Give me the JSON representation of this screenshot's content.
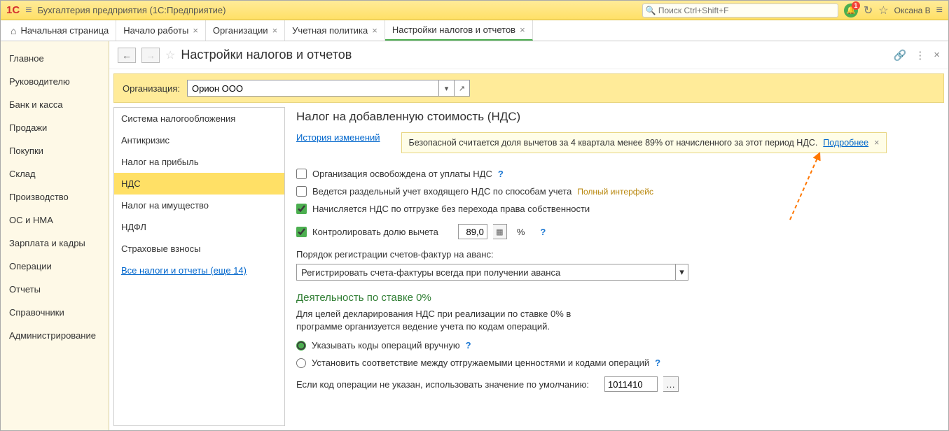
{
  "topbar": {
    "app_title": "Бухгалтерия предприятия  (1С:Предприятие)",
    "search_placeholder": "Поиск Ctrl+Shift+F",
    "bell_count": "1",
    "user_name": "Оксана В"
  },
  "tabs": [
    {
      "label": "Начальная страница",
      "home": true
    },
    {
      "label": "Начало работы"
    },
    {
      "label": "Организации"
    },
    {
      "label": "Учетная политика"
    },
    {
      "label": "Настройки налогов и отчетов",
      "active": true
    }
  ],
  "sidenav": [
    "Главное",
    "Руководителю",
    "Банк и касса",
    "Продажи",
    "Покупки",
    "Склад",
    "Производство",
    "ОС и НМА",
    "Зарплата и кадры",
    "Операции",
    "Отчеты",
    "Справочники",
    "Администрирование"
  ],
  "page_title": "Настройки налогов и отчетов",
  "org": {
    "label": "Организация:",
    "value": "Орион ООО"
  },
  "settings_nav": [
    "Система налогообложения",
    "Антикризис",
    "Налог на прибыль",
    "НДС",
    "Налог на имущество",
    "НДФЛ",
    "Страховые взносы"
  ],
  "settings_nav_link": "Все налоги и отчеты (еще 14)",
  "form": {
    "heading": "Налог на добавленную стоимость (НДС)",
    "history_link": "История изменений",
    "notice_text": "Безопасной считается доля вычетов за 4 квартала менее 89% от начисленного за этот период НДС.",
    "notice_more": "Подробнее",
    "cb_exempt": "Организация освобождена от уплаты НДС",
    "cb_separate": "Ведется раздельный учет входящего НДС по способам учета",
    "cb_separate_hint": "Полный интерфейс",
    "cb_shipment": "Начисляется НДС по отгрузке без перехода права собственности",
    "cb_control": "Контролировать долю вычета",
    "control_value": "89,0",
    "percent": "%",
    "order_label": "Порядок регистрации счетов-фактур на аванс:",
    "order_value": "Регистрировать счета-фактуры всегда при получении аванса",
    "zero_heading": "Деятельность по ставке 0%",
    "zero_desc": "Для целей декларирования НДС при реализации по ставке 0% в программе организуется ведение учета по кодам операций.",
    "radio_manual": "Указывать коды операций вручную",
    "radio_auto": "Установить соответствие между отгружаемыми ценностями и кодами операций",
    "default_label": "Если код операции не указан, использовать значение по умолчанию:",
    "default_value": "1011410"
  }
}
